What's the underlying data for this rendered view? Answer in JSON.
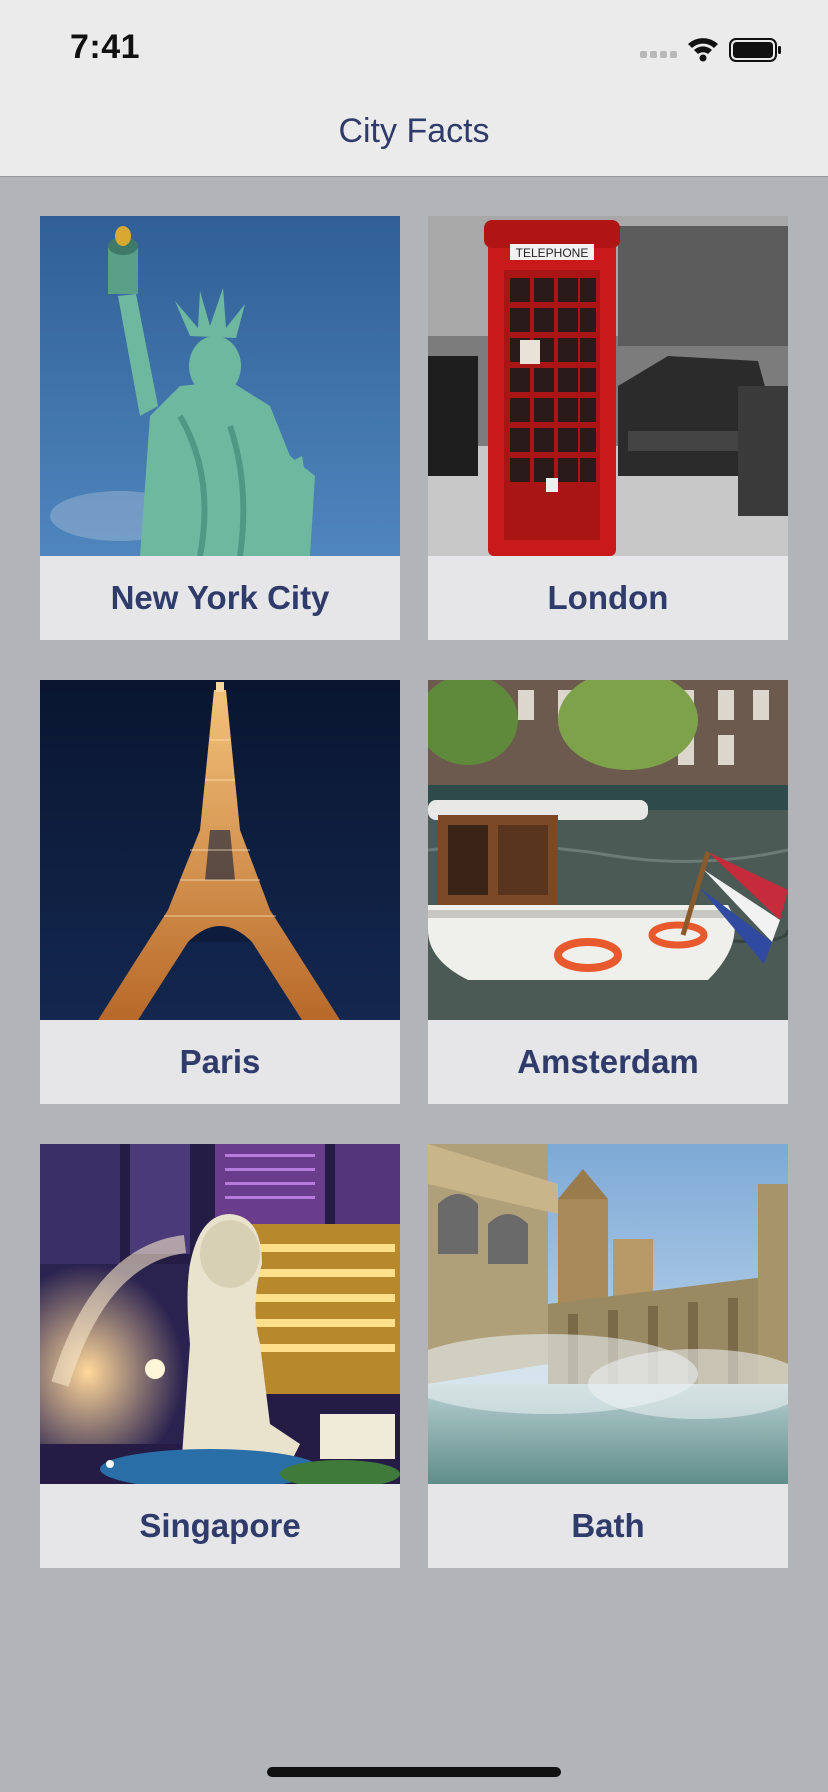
{
  "status_bar": {
    "time": "7:41"
  },
  "nav": {
    "title": "City Facts"
  },
  "cities": [
    {
      "name": "New York City",
      "image": "statue-of-liberty-photo"
    },
    {
      "name": "London",
      "image": "red-telephone-box-photo"
    },
    {
      "name": "Paris",
      "image": "eiffel-tower-photo"
    },
    {
      "name": "Amsterdam",
      "image": "canal-boat-photo"
    },
    {
      "name": "Singapore",
      "image": "merlion-photo"
    },
    {
      "name": "Bath",
      "image": "roman-baths-photo"
    }
  ]
}
